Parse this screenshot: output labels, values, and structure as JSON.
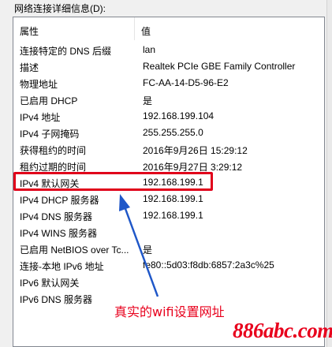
{
  "dialog": {
    "caption": "网络连接详细信息(D):"
  },
  "table": {
    "headers": {
      "property": "属性",
      "value": "值"
    },
    "rows": [
      {
        "property": "连接特定的 DNS 后缀",
        "value": "lan"
      },
      {
        "property": "描述",
        "value": "Realtek PCIe GBE Family Controller"
      },
      {
        "property": "物理地址",
        "value": "FC-AA-14-D5-96-E2"
      },
      {
        "property": "已启用 DHCP",
        "value": "是"
      },
      {
        "property": "IPv4 地址",
        "value": "192.168.199.104"
      },
      {
        "property": "IPv4 子网掩码",
        "value": "255.255.255.0"
      },
      {
        "property": "获得租约的时间",
        "value": "2016年9月26日 15:29:12"
      },
      {
        "property": "租约过期的时间",
        "value": "2016年9月27日 3:29:12"
      },
      {
        "property": "IPv4 默认网关",
        "value": "192.168.199.1"
      },
      {
        "property": "IPv4 DHCP 服务器",
        "value": "192.168.199.1"
      },
      {
        "property": "IPv4 DNS 服务器",
        "value": "192.168.199.1"
      },
      {
        "property": "IPv4 WINS 服务器",
        "value": ""
      },
      {
        "property": "已启用 NetBIOS over Tc...",
        "value": "是"
      },
      {
        "property": "连接-本地 IPv6 地址",
        "value": "fe80::5d03:f8db:6857:2a3c%25"
      },
      {
        "property": "IPv6 默认网关",
        "value": ""
      },
      {
        "property": "IPv6 DNS 服务器",
        "value": ""
      }
    ]
  },
  "annotation": {
    "text": "真实的wifi设置网址",
    "color": "#e8001c"
  },
  "watermark": {
    "text": "886abc.com"
  },
  "colors": {
    "highlight_border": "#e0001a",
    "arrow": "#1f57c8"
  }
}
